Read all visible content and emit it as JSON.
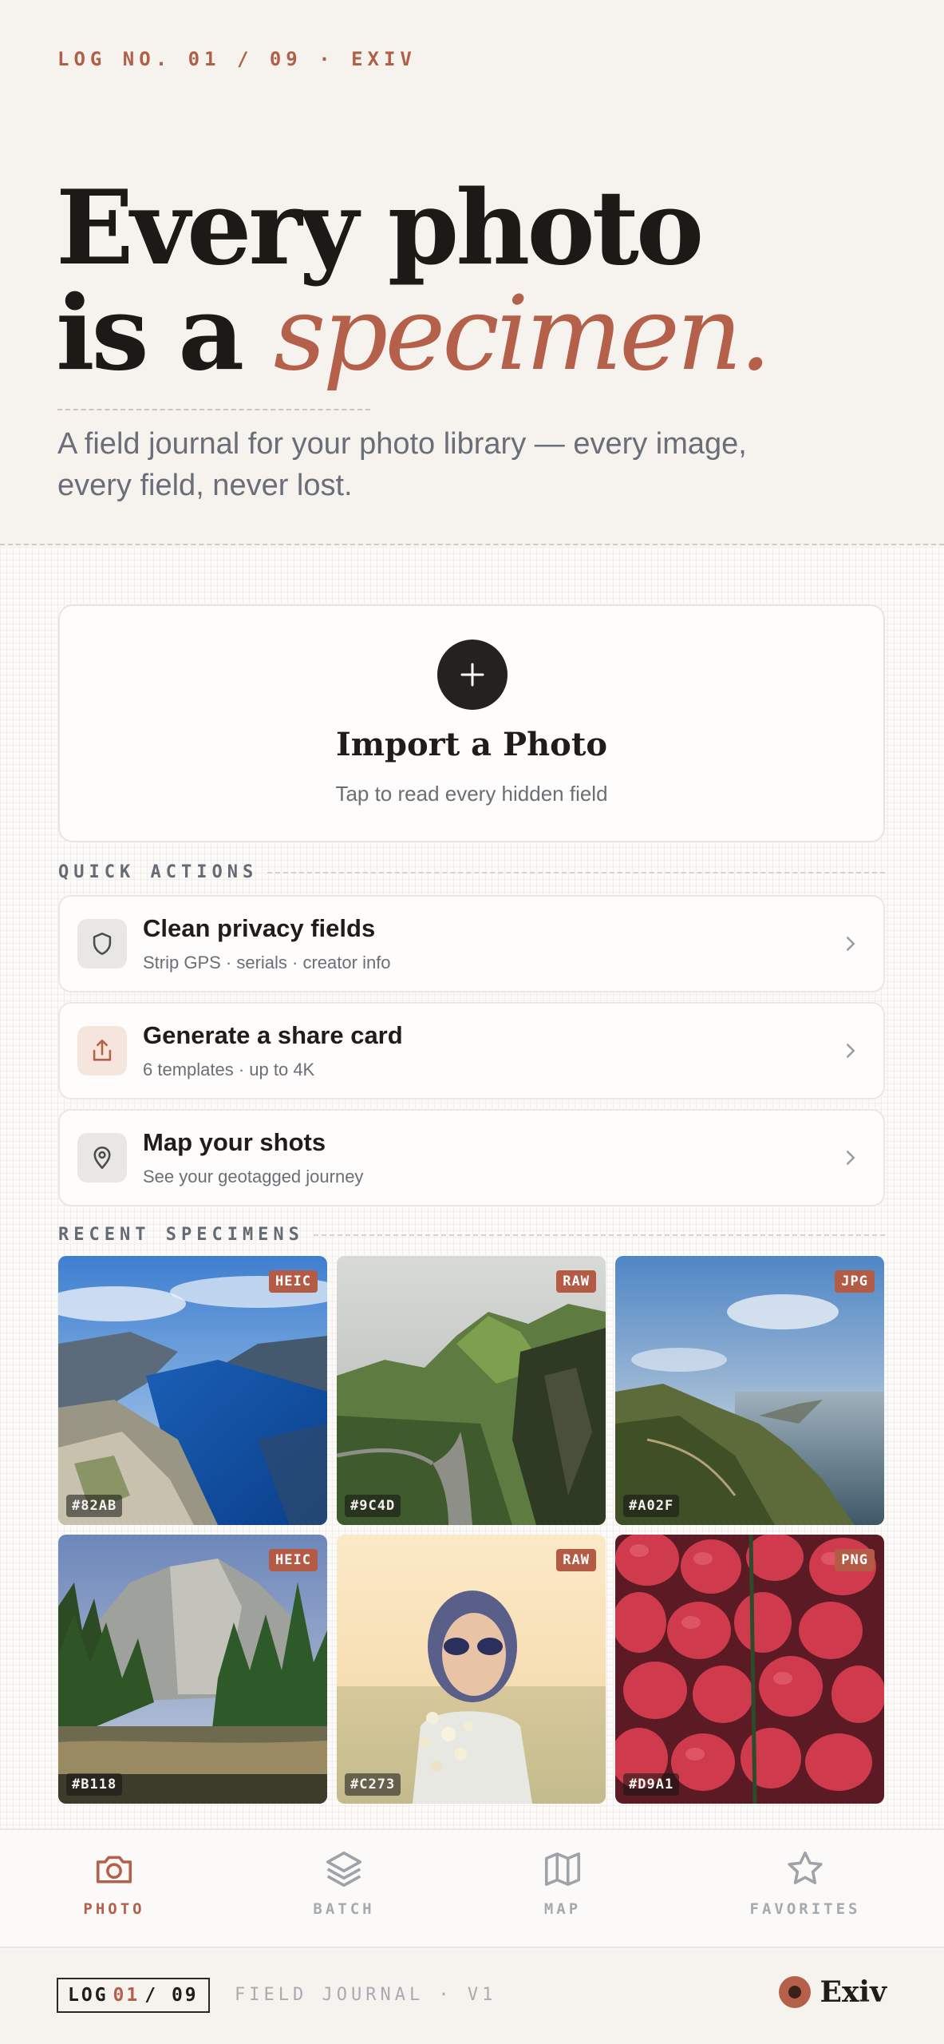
{
  "hero": {
    "log_line": "LOG NO. 01 / 09 · EXIV",
    "headline_line1": "Every photo",
    "headline_line2_prefix": "is a ",
    "headline_accent": "specimen.",
    "subtitle": "A field journal for your photo library — every image, every field, never lost."
  },
  "import": {
    "icon": "plus-icon",
    "title": "Import a Photo",
    "subtitle": "Tap to read every hidden field"
  },
  "quick_actions": {
    "label": "QUICK ACTIONS",
    "items": [
      {
        "icon": "shield-icon",
        "title": "Clean privacy fields",
        "subtitle": "Strip GPS · serials · creator info"
      },
      {
        "icon": "share-icon",
        "title": "Generate a share card",
        "subtitle": "6 templates · up to 4K"
      },
      {
        "icon": "map-pin-icon",
        "title": "Map your shots",
        "subtitle": "See your geotagged journey"
      }
    ]
  },
  "recent": {
    "label": "RECENT SPECIMENS",
    "tiles": [
      {
        "format": "HEIC",
        "id": "#82AB",
        "subject": "fjord-landscape"
      },
      {
        "format": "RAW",
        "id": "#9C4D",
        "subject": "green-hills-road"
      },
      {
        "format": "JPG",
        "id": "#A02F",
        "subject": "coastal-cliffs"
      },
      {
        "format": "HEIC",
        "id": "#B118",
        "subject": "valley-cliffs-forest"
      },
      {
        "format": "RAW",
        "id": "#C273",
        "subject": "woman-with-flowers"
      },
      {
        "format": "PNG",
        "id": "#D9A1",
        "subject": "strawberries"
      }
    ]
  },
  "tabbar": {
    "items": [
      {
        "icon": "camera-icon",
        "label": "PHOTO",
        "active": true
      },
      {
        "icon": "layers-icon",
        "label": "BATCH",
        "active": false
      },
      {
        "icon": "map-icon",
        "label": "MAP",
        "active": false
      },
      {
        "icon": "star-icon",
        "label": "FAVORITES",
        "active": false
      }
    ]
  },
  "footer": {
    "log_prefix": "LOG",
    "log_current": "01",
    "log_total": "/ 09",
    "journal": "FIELD JOURNAL · V1",
    "brand": "Exiv"
  },
  "colors": {
    "accent": "#b5604a",
    "ink": "#1f1d1a",
    "muted": "#6a6e76",
    "paper": "#f6f3ee"
  }
}
